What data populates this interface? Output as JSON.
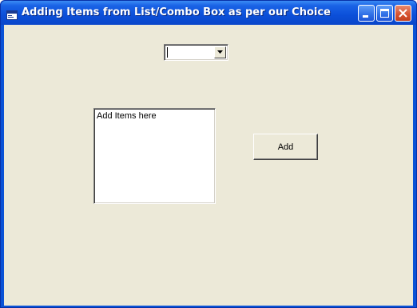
{
  "window": {
    "title": "Adding Items from List/Combo Box as per our Choice",
    "icon": "app-window-icon",
    "controls": [
      "minimize-icon",
      "maximize-icon",
      "close-icon"
    ]
  },
  "combo": {
    "value": "",
    "dropdown_icon": "chevron-down-icon"
  },
  "listbox": {
    "items": [
      "Add Items here"
    ]
  },
  "buttons": {
    "add_label": "Add"
  },
  "colors": {
    "titlebar": "#0a52d6",
    "client": "#ece9d8",
    "close_button": "#d6512f"
  }
}
